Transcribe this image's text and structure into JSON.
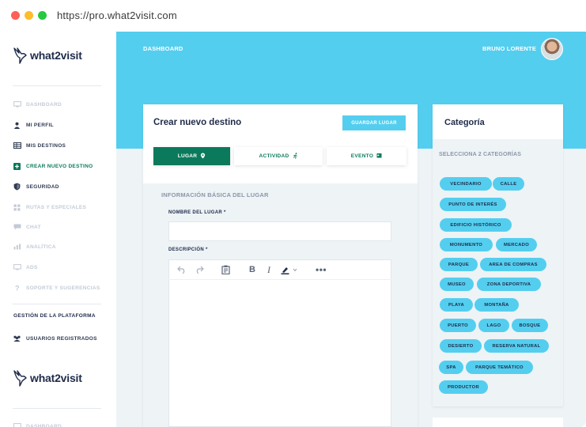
{
  "browser": {
    "url": "https://pro.what2visit.com"
  },
  "brand": {
    "logo_text": "what2visit",
    "logo_text_2": "what2visit"
  },
  "sidebar": {
    "items": [
      {
        "label": "DASHBOARD",
        "icon": "monitor-icon",
        "state": "dim"
      },
      {
        "label": "MI PERFIL",
        "icon": "user-icon",
        "state": "normal"
      },
      {
        "label": "MIS DESTINOS",
        "icon": "table-icon",
        "state": "normal"
      },
      {
        "label": "CREAR NUEVO DESTINO",
        "icon": "plus-square-icon",
        "state": "active"
      },
      {
        "label": "SEGURIDAD",
        "icon": "shield-icon",
        "state": "normal"
      },
      {
        "label": "RUTAS Y ESPECIALES",
        "icon": "grid-icon",
        "state": "dim"
      },
      {
        "label": "CHAT",
        "icon": "chat-icon",
        "state": "dim"
      },
      {
        "label": "ANALÍTICA",
        "icon": "chart-icon",
        "state": "dim"
      },
      {
        "label": "ADS",
        "icon": "monitor-icon",
        "state": "dim"
      },
      {
        "label": "SOPORTE Y SUGERENCIAS",
        "icon": "question-icon",
        "state": "dim"
      }
    ],
    "section_title": "GESTIÓN DE LA PLATAFORMA",
    "platform_items": [
      {
        "label": "USUARIOS REGISTRADOS",
        "icon": "users-icon",
        "state": "normal"
      }
    ],
    "repeat_item": {
      "label": "DASHBOARD",
      "icon": "monitor-icon",
      "state": "dim"
    }
  },
  "header": {
    "title": "DASHBOARD",
    "user_name": "BRUNO LORENTE"
  },
  "form": {
    "title": "Crear nuevo destino",
    "save_label": "GUARDAR LUGAR",
    "tabs": [
      {
        "label": "LUGAR",
        "icon": "map-pin-icon",
        "active": true
      },
      {
        "label": "ACTIVIDAD",
        "icon": "running-icon",
        "active": false
      },
      {
        "label": "EVENTO",
        "icon": "calendar-icon",
        "active": false
      }
    ],
    "section_heading": "INFORMACIÓN BÁSICA DEL LUGAR",
    "nombre_label": "NOMBRE DEL LUGAR *",
    "nombre_value": "",
    "descripcion_label": "DESCRIPCIÓN *",
    "toolbar": [
      "undo-icon",
      "redo-icon",
      "clipboard-icon",
      "bold-icon",
      "italic-icon",
      "highlighter-icon",
      "more-icon"
    ]
  },
  "category": {
    "title": "Categoría",
    "subtitle": "SELECCIONA 2 CATEGORÍAS",
    "chips": [
      "VECINDARIO",
      "CALLE",
      "PUNTO DE INTERÉS",
      "EDIFICIO HISTÓRICO",
      "MONUMENTO",
      "MERCADO",
      "PARQUE",
      "AREA DE COMPRAS",
      "MUSEO",
      "ZONA DEPORTIVA",
      "PLAYA",
      "MONTAÑA",
      "PUERTO",
      "LAGO",
      "BOSQUE",
      "DESIERTO",
      "RESERVA NATURAL",
      "SPA",
      "PARQUE TEMÁTICO",
      "PRODUCTOR"
    ]
  },
  "colors": {
    "accent": "#54ceef",
    "primary": "#0b7a5c",
    "text": "#1e2b4a",
    "muted": "#8c97a8"
  }
}
